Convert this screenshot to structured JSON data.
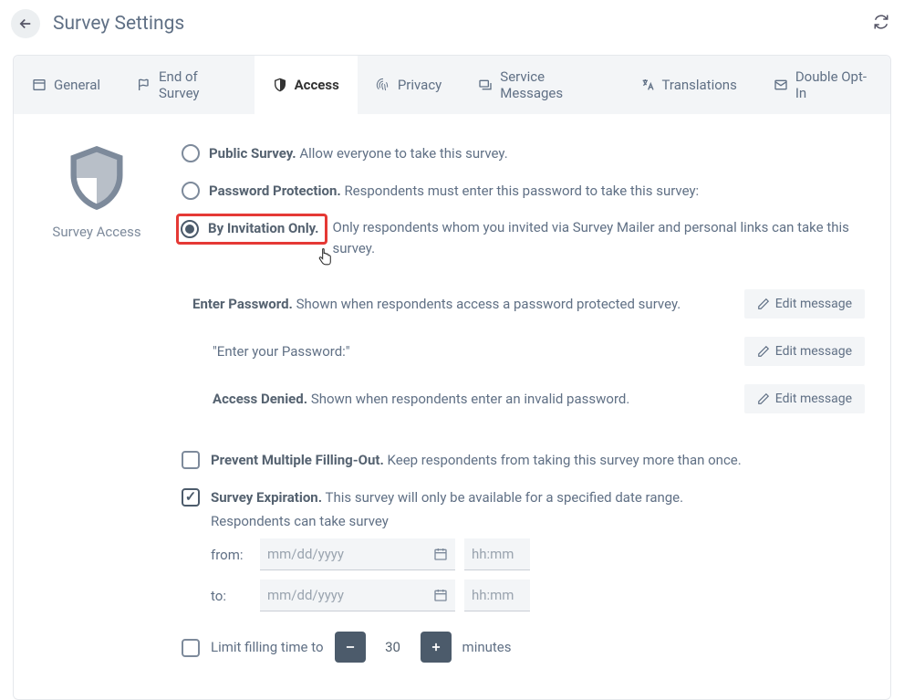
{
  "header": {
    "title": "Survey Settings"
  },
  "tabs": {
    "general": "General",
    "end": "End of Survey",
    "access": "Access",
    "privacy": "Privacy",
    "messages": "Service Messages",
    "translations": "Translations",
    "doubleOptIn": "Double Opt-In"
  },
  "side": {
    "label": "Survey Access"
  },
  "access": {
    "public": {
      "label": "Public Survey.",
      "desc": "Allow everyone to take this survey."
    },
    "password": {
      "label": "Password Protection.",
      "desc": "Respondents must enter this password to take this survey:"
    },
    "invite": {
      "label": "By Invitation Only.",
      "desc": "Only respondents whom you invited via Survey Mailer and personal links can take this survey."
    }
  },
  "messages": {
    "enterPwd": {
      "label": "Enter Password.",
      "desc": "Shown when respondents access a password protected survey."
    },
    "quoted": "\"Enter your Password:\"",
    "denied": {
      "label": "Access Denied.",
      "desc": "Shown when respondents enter an invalid password."
    },
    "editBtn": "Edit message"
  },
  "options": {
    "prevent": {
      "label": "Prevent Multiple Filling-Out.",
      "desc": "Keep respondents from taking this survey more than once."
    },
    "expiration": {
      "label": "Survey Expiration.",
      "desc": "This survey will only be available for a specified date range.",
      "sub": "Respondents can take survey",
      "from": "from:",
      "to": "to:",
      "datePh": "mm/dd/yyyy",
      "timePh": "hh:mm"
    },
    "limit": {
      "label": "Limit filling time to",
      "value": "30",
      "unit": "minutes"
    }
  }
}
